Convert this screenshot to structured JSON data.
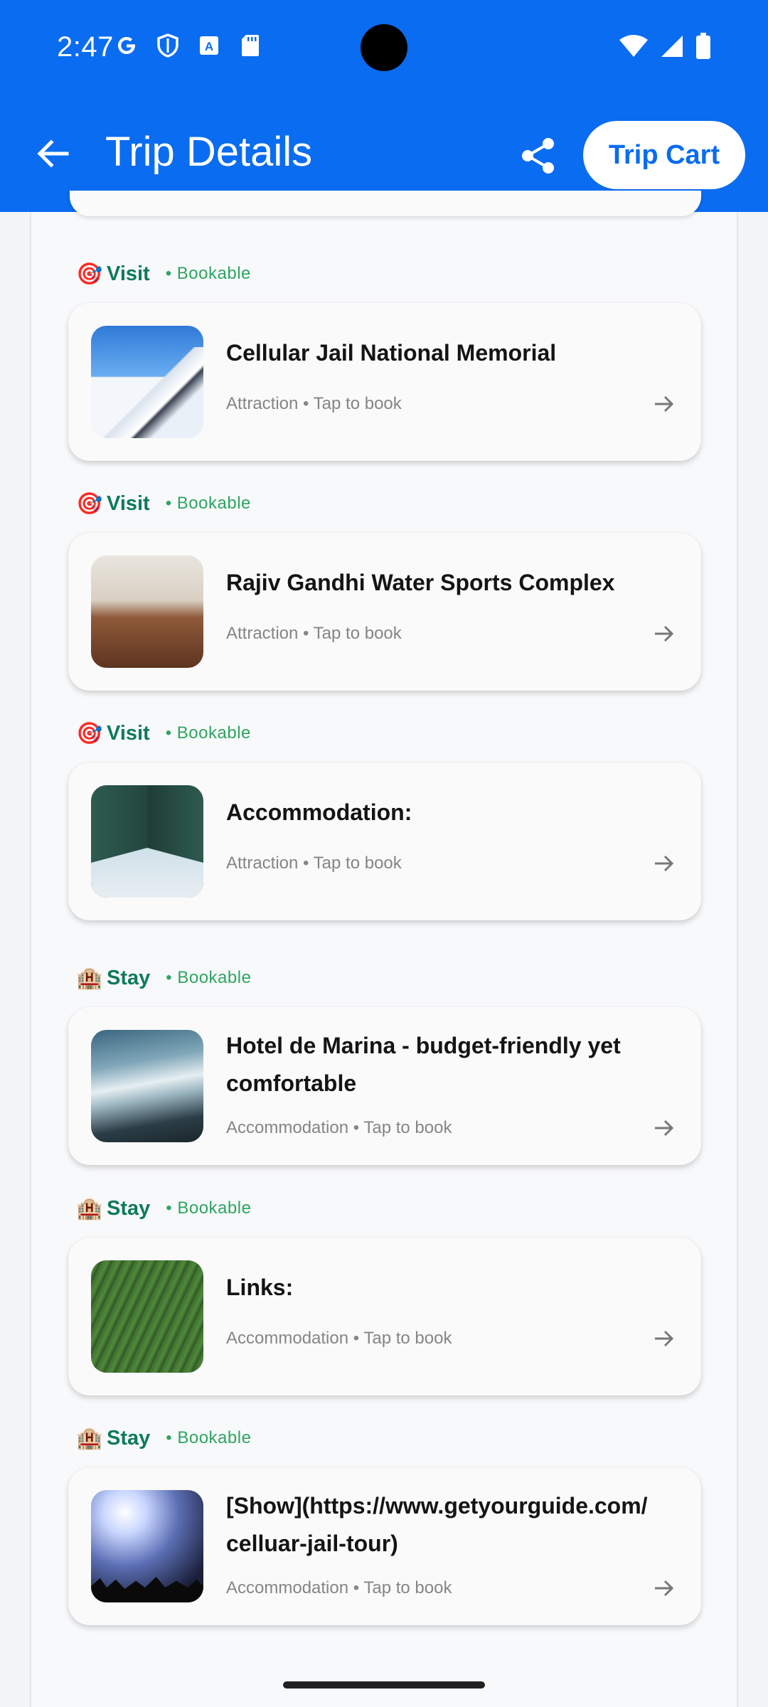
{
  "status_bar": {
    "time": "2:47",
    "left_icons": [
      "google-g-icon",
      "shield-icon",
      "a-badge-icon",
      "sd-card-icon"
    ],
    "right_icons": [
      "wifi-icon",
      "signal-icon",
      "battery-icon"
    ]
  },
  "app_bar": {
    "title": "Trip Details",
    "cart_label": "Trip Cart",
    "color": "#0a6cf0"
  },
  "items": [
    {
      "section": "Visit",
      "section_icon": "🎯",
      "badge": "• Bookable",
      "name": "Cellular Jail National Memorial",
      "meta": "Attraction • Tap to book",
      "thumb": "mountain-photo"
    },
    {
      "section": "Visit",
      "section_icon": "🎯",
      "badge": "• Bookable",
      "name": "Rajiv Gandhi Water Sports Complex",
      "meta": "Attraction • Tap to book",
      "thumb": "cafe-table-photo"
    },
    {
      "section": "Visit",
      "section_icon": "🎯",
      "badge": "• Bookable",
      "name": "Accommodation:",
      "meta": "Attraction • Tap to book",
      "thumb": "bridge-underside-photo"
    },
    {
      "section": "Stay",
      "section_icon": "🏨",
      "badge": "• Bookable",
      "name": "Hotel de Marina - budget-friendly yet comfortable",
      "meta": "Accommodation • Tap to book",
      "thumb": "ocean-waves-photo"
    },
    {
      "section": "Stay",
      "section_icon": "🏨",
      "badge": "• Bookable",
      "name": "Links:",
      "meta": "Accommodation • Tap to book",
      "thumb": "tea-field-photo"
    },
    {
      "section": "Stay",
      "section_icon": "🏨",
      "badge": "• Bookable",
      "name": "[Show](https://www.getyourguide.com/celluar-jail-tour)",
      "meta": "Accommodation • Tap to book",
      "thumb": "concert-photo"
    }
  ],
  "colors": {
    "section_label": "#0e7a5a",
    "bookable": "#2ea561",
    "meta_text": "#858585"
  }
}
